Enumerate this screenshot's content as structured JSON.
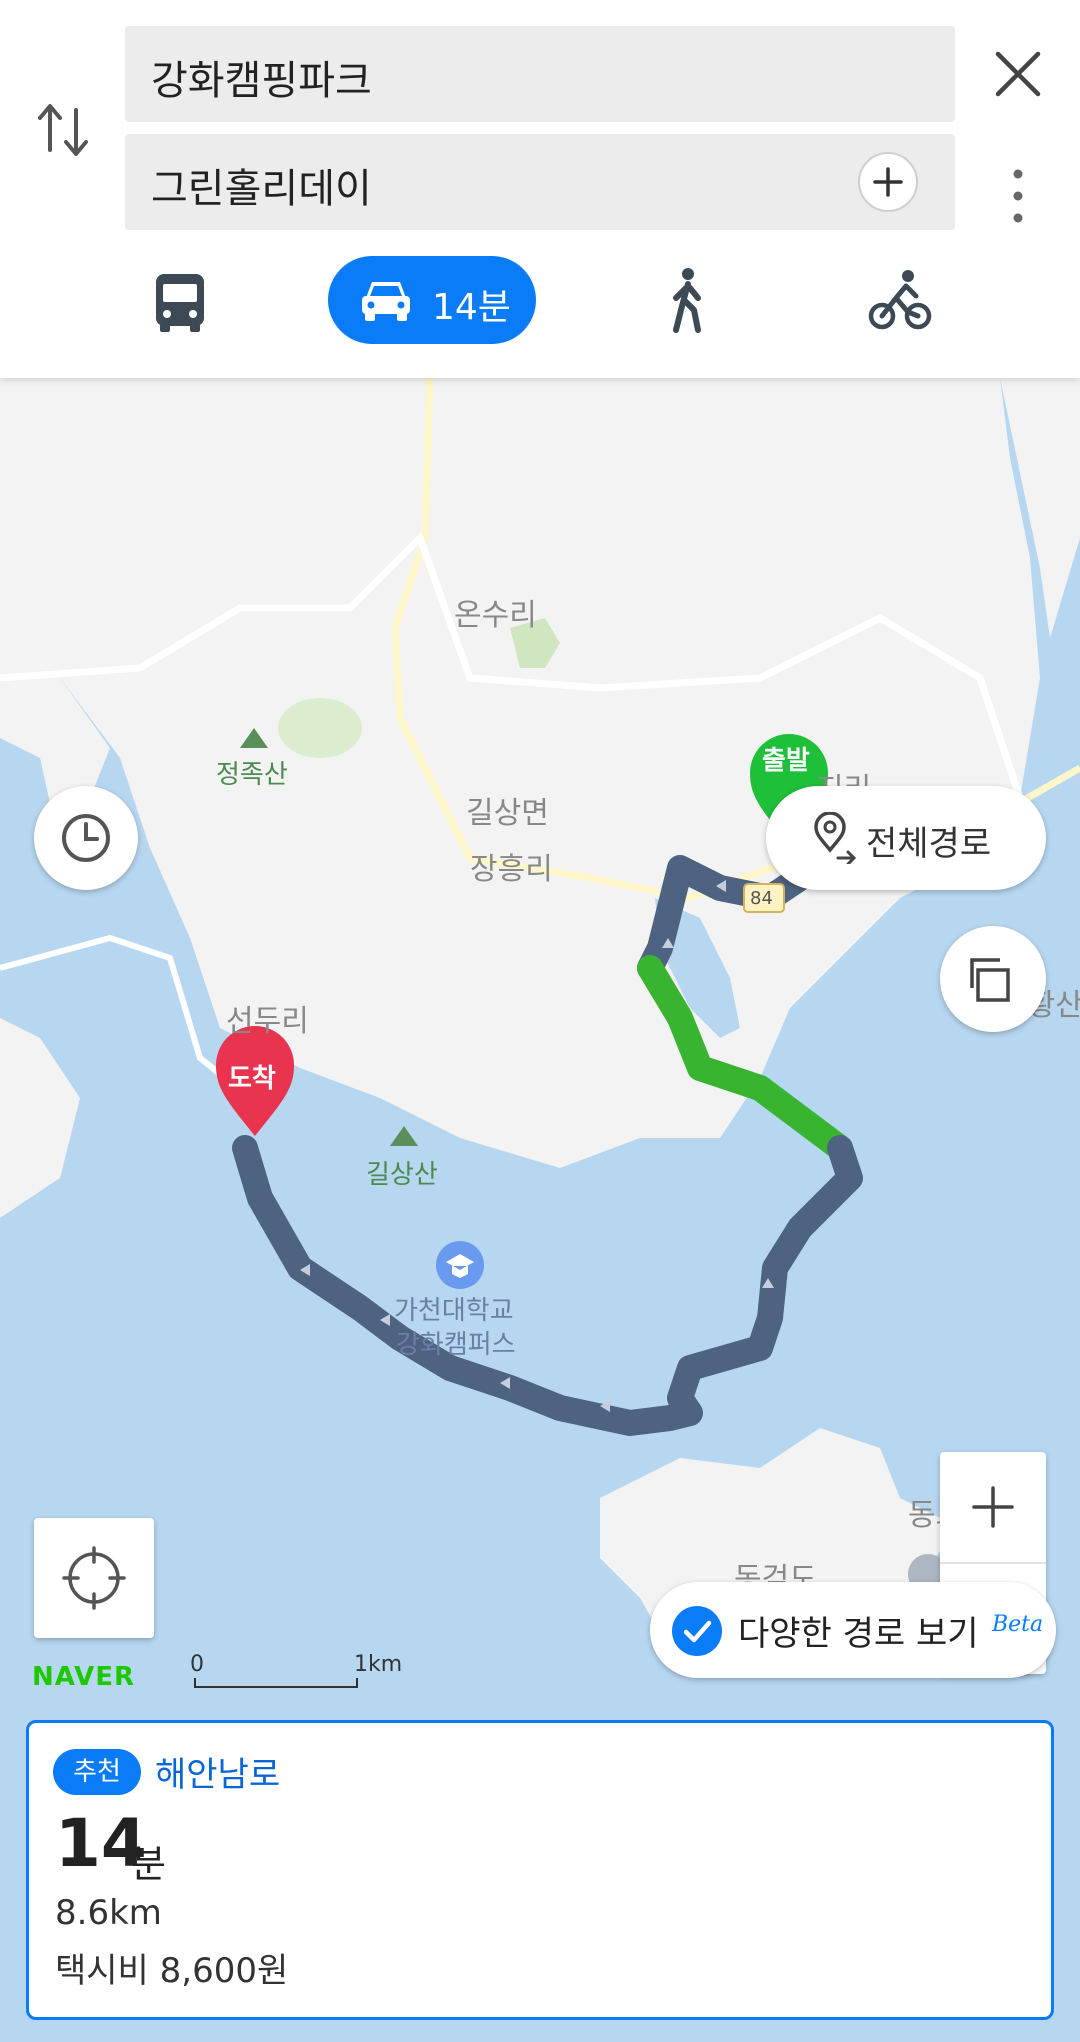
{
  "search": {
    "origin": "강화캠핑파크",
    "destination": "그린홀리데이"
  },
  "modes": {
    "car_time": "14분"
  },
  "map": {
    "labels": {
      "onsuri": "온수리",
      "jeongjoksan": "정족산",
      "gilsangmyeon": "길상면",
      "janghungri": "장흥리",
      "jiri": "지리",
      "seonduri": "선두리",
      "gilsangsan": "길상산",
      "sohwangsan": "소황산",
      "donggrangseom": "동그랑섬",
      "donggeomdo": "동검도",
      "gachon1": "가천대학교",
      "gachon2": "강화캠퍼스",
      "road_number": "84"
    },
    "start_marker": "출발",
    "end_marker": "도착",
    "full_route": "전체경로",
    "various_routes": "다양한 경로 보기",
    "beta": "Beta",
    "naver": "NAVER",
    "scale_start": "0",
    "scale_end": "1km"
  },
  "route_card": {
    "badge": "추천",
    "route_name": "해안남로",
    "time_value": "14",
    "time_unit": "분",
    "distance": "8.6km",
    "taxi_fare": "택시비 8,600원"
  }
}
